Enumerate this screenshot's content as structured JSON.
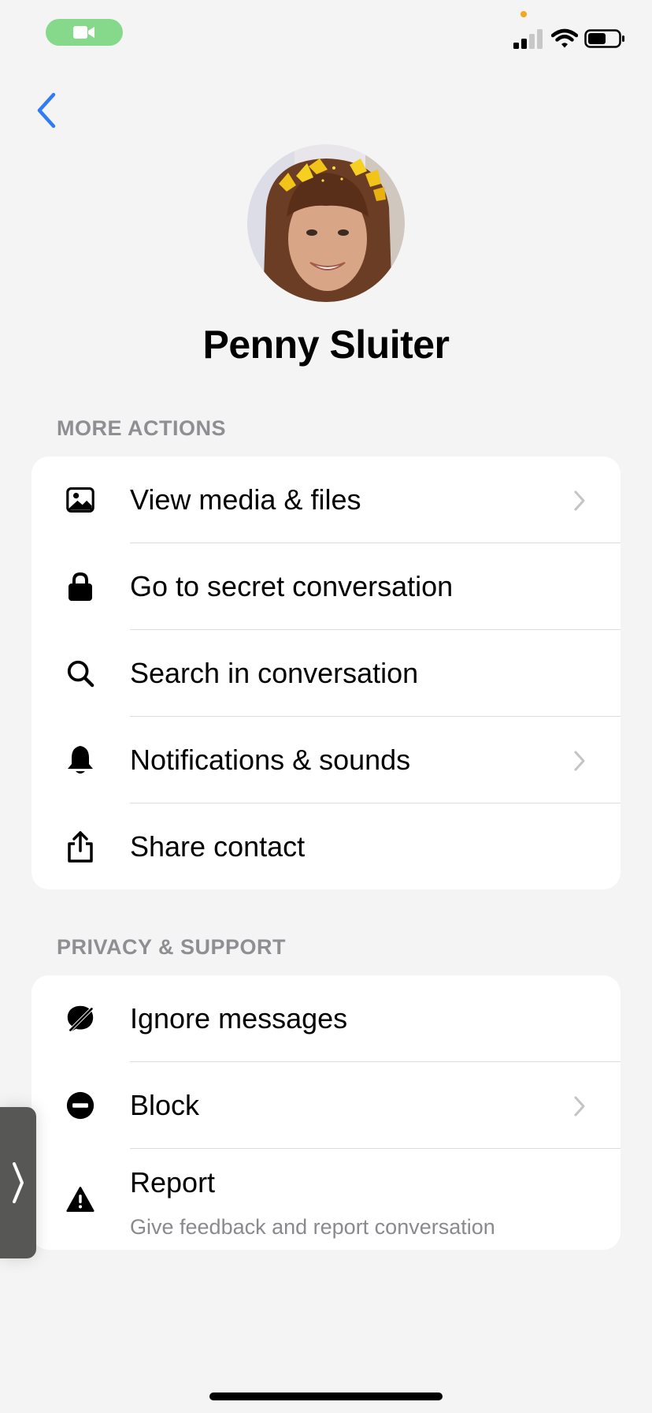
{
  "header": {
    "name": "Penny Sluiter"
  },
  "sections": {
    "more_actions": {
      "title": "MORE ACTIONS",
      "items": [
        {
          "label": "View media & files",
          "icon": "photo-icon",
          "chevron": true
        },
        {
          "label": "Go to secret conversation",
          "icon": "lock-icon",
          "chevron": false
        },
        {
          "label": "Search in conversation",
          "icon": "search-icon",
          "chevron": false
        },
        {
          "label": "Notifications & sounds",
          "icon": "bell-icon",
          "chevron": true
        },
        {
          "label": "Share contact",
          "icon": "share-icon",
          "chevron": false
        }
      ]
    },
    "privacy_support": {
      "title": "PRIVACY & SUPPORT",
      "items": [
        {
          "label": "Ignore messages",
          "icon": "ignore-icon",
          "chevron": false
        },
        {
          "label": "Block",
          "icon": "block-icon",
          "chevron": true
        },
        {
          "label": "Report",
          "sublabel": "Give feedback and report conversation",
          "icon": "warning-icon",
          "chevron": false
        }
      ]
    }
  },
  "colors": {
    "background": "#f4f4f4",
    "accent": "#2f7cf6",
    "camera_indicator": "#86d98a",
    "section_header": "#8e8e93"
  }
}
